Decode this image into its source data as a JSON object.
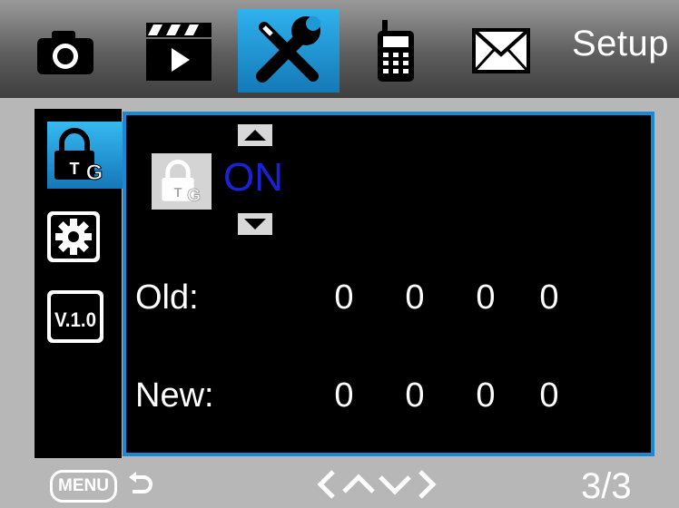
{
  "header": {
    "title": "Setup",
    "tabs": [
      {
        "name": "camera-icon",
        "active": false
      },
      {
        "name": "video-clapper-icon",
        "active": false
      },
      {
        "name": "tools-icon",
        "active": true
      },
      {
        "name": "cellphone-icon",
        "active": false
      },
      {
        "name": "envelope-icon",
        "active": false
      }
    ]
  },
  "sidebar": {
    "items": [
      {
        "icon": "password-lock-icon",
        "active": true
      },
      {
        "icon": "gear-icon",
        "active": false
      },
      {
        "icon": "version-icon",
        "label": "V.1.0",
        "active": false
      }
    ]
  },
  "password": {
    "state": "ON",
    "old_label": "Old:",
    "new_label": "New:",
    "old_digits": [
      "0",
      "0",
      "0",
      "0"
    ],
    "new_digits": [
      "0",
      "0",
      "0",
      "0"
    ]
  },
  "footer": {
    "menu_label": "MENU",
    "page": "3/3"
  },
  "colors": {
    "accent": "#1b88d6",
    "state_text": "#1a22d8"
  }
}
